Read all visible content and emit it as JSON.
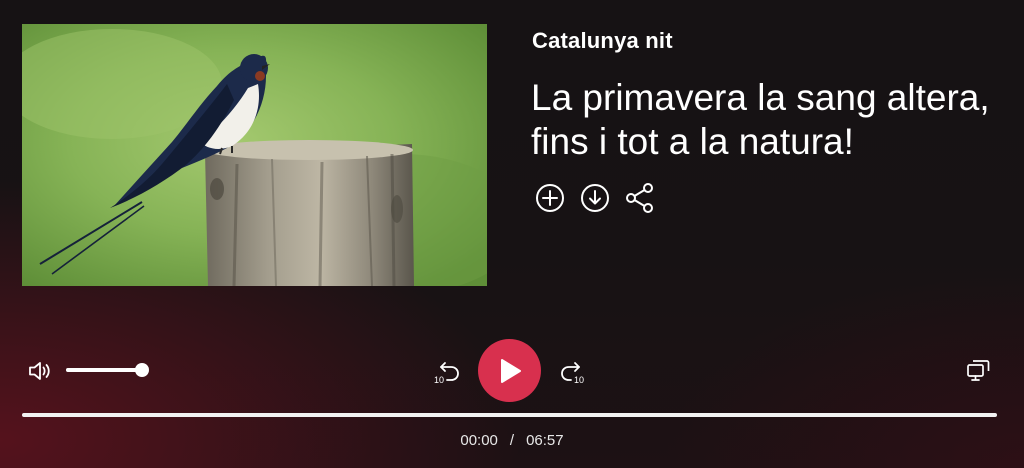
{
  "episode": {
    "program": "Catalunya nit",
    "title": "La primavera la sang altera, fins i tot a la natura!"
  },
  "actions": [
    {
      "icon": "plus-circle-icon",
      "name": "add-to-list-button"
    },
    {
      "icon": "download-circle-icon",
      "name": "download-button"
    },
    {
      "icon": "share-icon",
      "name": "share-button"
    }
  ],
  "player": {
    "volume": 1.0,
    "skip_back_seconds": "10",
    "skip_forward_seconds": "10",
    "progress": 0.0,
    "current_time": "00:00",
    "separator": "/",
    "duration": "06:57",
    "accent_color": "#d8304e"
  },
  "icons": {
    "volume": "volume-icon",
    "play": "play-icon",
    "rewind": "rewind-10-icon",
    "forward": "forward-10-icon",
    "screen": "cast-screen-icon"
  }
}
